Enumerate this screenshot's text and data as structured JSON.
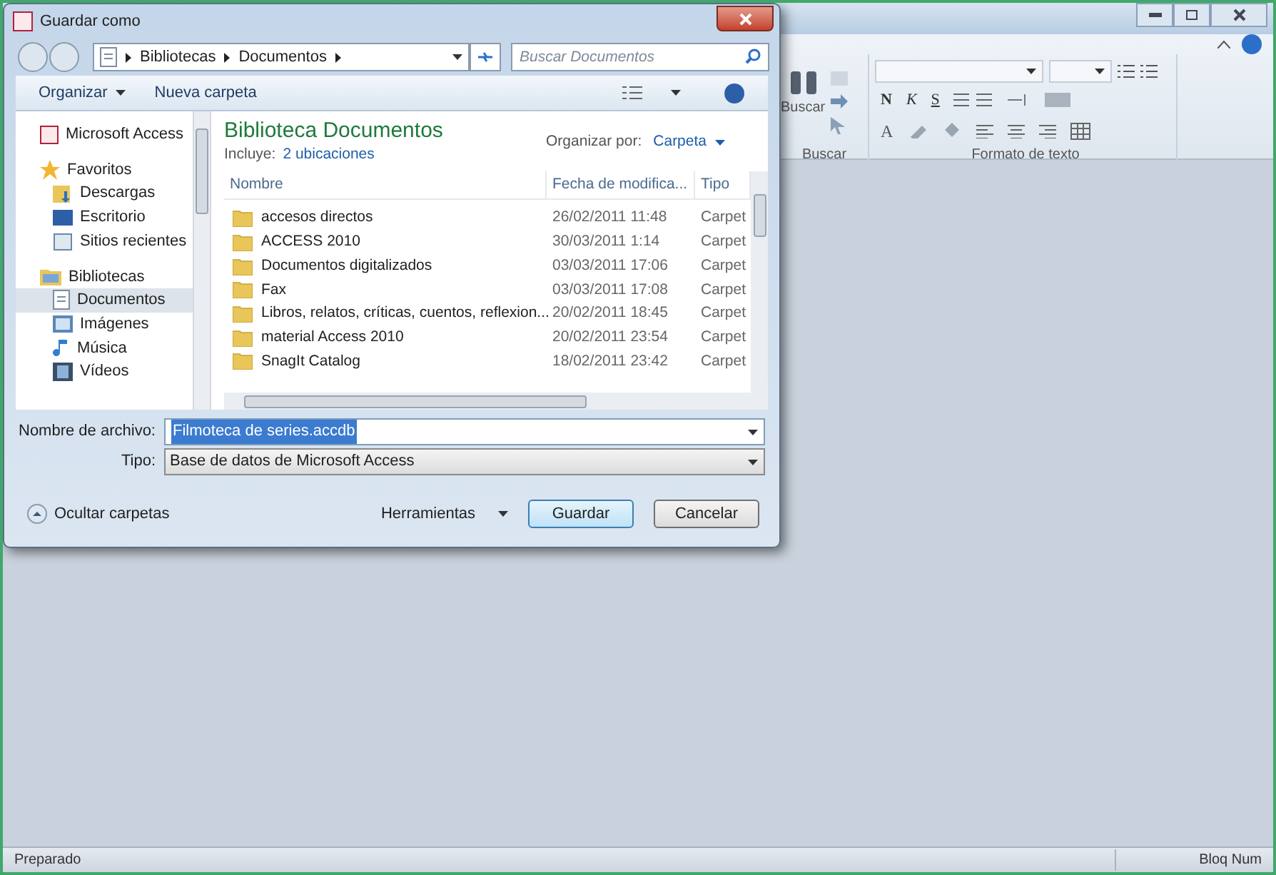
{
  "ribbon": {
    "groups": [
      {
        "kind": "search",
        "button_label": "Buscar",
        "label": "Buscar"
      },
      {
        "kind": "text_format",
        "format_buttons": [
          "N",
          "K",
          "S"
        ],
        "font_color_button": "A",
        "label": "Formato de texto"
      }
    ]
  },
  "status_bar": {
    "left": "Preparado",
    "right": "Bloq Num"
  },
  "dialog": {
    "title": "Guardar como",
    "breadcrumbs": [
      "Bibliotecas",
      "Documentos"
    ],
    "search": {
      "placeholder": "Buscar Documentos"
    },
    "toolbar": {
      "organize": "Organizar",
      "new_folder": "Nueva carpeta"
    },
    "nav": [
      {
        "label": "Microsoft Access",
        "kind": "app",
        "selected": false
      },
      {
        "label": "Favoritos",
        "kind": "favorites",
        "selected": false,
        "children": [
          {
            "label": "Descargas",
            "kind": "downloads",
            "selected": false
          },
          {
            "label": "Escritorio",
            "kind": "desktop",
            "selected": false
          },
          {
            "label": "Sitios recientes",
            "kind": "recent",
            "selected": false
          }
        ]
      },
      {
        "label": "Bibliotecas",
        "kind": "libraries",
        "selected": false,
        "children": [
          {
            "label": "Documentos",
            "kind": "documents",
            "selected": true
          },
          {
            "label": "Imágenes",
            "kind": "pictures",
            "selected": false
          },
          {
            "label": "Música",
            "kind": "music",
            "selected": false
          },
          {
            "label": "Vídeos",
            "kind": "videos",
            "selected": false
          }
        ]
      }
    ],
    "library": {
      "title": "Biblioteca Documentos",
      "includes_label": "Incluye:",
      "includes_link": "2 ubicaciones",
      "arrange_label": "Organizar por:",
      "arrange_value": "Carpeta"
    },
    "table": {
      "columns": [
        "Nombre",
        "Fecha de modifica...",
        "Tipo"
      ],
      "rows": [
        {
          "name": "accesos directos",
          "date": "26/02/2011 11:48",
          "type": "Carpet"
        },
        {
          "name": "ACCESS 2010",
          "date": "30/03/2011 1:14",
          "type": "Carpet"
        },
        {
          "name": "Documentos digitalizados",
          "date": "03/03/2011 17:06",
          "type": "Carpet"
        },
        {
          "name": "Fax",
          "date": "03/03/2011 17:08",
          "type": "Carpet"
        },
        {
          "name": "Libros, relatos, críticas, cuentos, reflexion...",
          "date": "20/02/2011 18:45",
          "type": "Carpet"
        },
        {
          "name": "material Access 2010",
          "date": "20/02/2011 23:54",
          "type": "Carpet"
        },
        {
          "name": "SnagIt Catalog",
          "date": "18/02/2011 23:42",
          "type": "Carpet"
        }
      ]
    },
    "filename": {
      "label": "Nombre de archivo:",
      "value": "Filmoteca de series.accdb"
    },
    "filetype": {
      "label": "Tipo:",
      "value": "Base de datos de Microsoft Access"
    },
    "hide_folders": "Ocultar carpetas",
    "tools": "Herramientas",
    "buttons": {
      "save": "Guardar",
      "cancel": "Cancelar"
    }
  }
}
